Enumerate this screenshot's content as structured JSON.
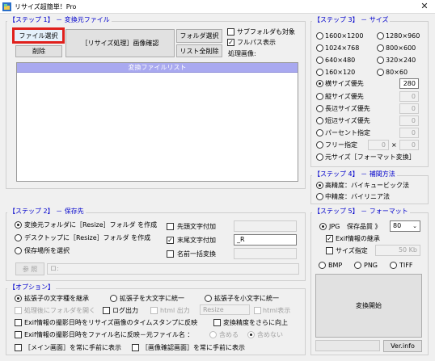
{
  "window": {
    "title": "リサイズ超簡単！Pro",
    "close_glyph": "✕"
  },
  "step1": {
    "title": "【ステップ 1】 － 変換元ファイル",
    "file_select": "ファイル選択",
    "delete": "削除",
    "resize_confirm": "［リサイズ処理］画像確認",
    "folder_select": "フォルダ選択",
    "list_clear": "リスト全削除",
    "subfolder": "サブフォルダも対象",
    "fullpath": "フルパス表示",
    "processing_image": "処理画像:",
    "list_header": "変換ファイルリスト"
  },
  "step2": {
    "title": "【ステップ 2】 － 保存先",
    "opt1": "変換元フォルダに［Resize］フォルダ を作成",
    "opt2": "デスクトップに［Resize］フォルダ を作成",
    "opt3": "保存場所を選択",
    "prefix": "先頭文字付加",
    "suffix": "末尾文字付加",
    "suffix_value": "_R",
    "rename": "名前一括変換",
    "browse": "参 照",
    "path_placeholder": "ロ:"
  },
  "step3": {
    "title": "【ステップ 3】 － サイズ",
    "sizes": [
      "1600×1200",
      "1280×960",
      "1024×768",
      "800×600",
      "640×480",
      "320×240",
      "160×120",
      "80×60"
    ],
    "width_priority": "横サイズ優先",
    "width_value": "280",
    "height_priority": "縦サイズ優先",
    "height_value": "0",
    "long_side": "長辺サイズ優先",
    "long_value": "0",
    "short_side": "短辺サイズ優先",
    "short_value": "0",
    "percent": "パーセント指定",
    "percent_value": "0",
    "free": "フリー指定",
    "free_w": "0",
    "times": "×",
    "free_h": "0",
    "original": "元サイズ［フォーマット変換］"
  },
  "step4": {
    "title": "【ステップ 4】 － 補間方法",
    "high": "高精度：バイキュービック法",
    "mid": "中精度：バイリニア法"
  },
  "step5": {
    "title": "【ステップ 5】 － フォーマット",
    "jpg": "JPG",
    "quality_label": "保存品質 》",
    "quality_value": "80",
    "exif": "Exif情報の継承",
    "size_spec": "サイズ指定",
    "size_value": "50",
    "size_unit": "Kb",
    "bmp": "BMP",
    "png": "PNG",
    "tiff": "TIFF",
    "convert": "変換開始",
    "version": "Ver.info"
  },
  "options": {
    "title": "【オプション】",
    "ext_inherit": "拡張子の文字種を継承",
    "ext_upper": "拡張子を大文字に統一",
    "ext_lower": "拡張子を小文字に統一",
    "open_folder": "処理後にフォルダを開く",
    "log": "ログ出力",
    "html": "html 出力",
    "html_value": "Resize",
    "html_view": "html表示",
    "exif_date": "Exif情報の撮影日時をリサイズ画像のタイムスタンプに反映",
    "precision": "変換精度をさらに向上",
    "exif_name": "Exif情報の撮影日時をファイル名に反映－元ファイル名 ：",
    "include": "含める",
    "exclude": "含めない",
    "main_front": "［メイン画面］を常に手前に表示",
    "confirm_front": "［画像確認画面］を常に手前に表示"
  },
  "colors": {
    "accent_title": "#0000cc",
    "highlight": "#e0201c",
    "list_header": "#a9a9f0"
  }
}
